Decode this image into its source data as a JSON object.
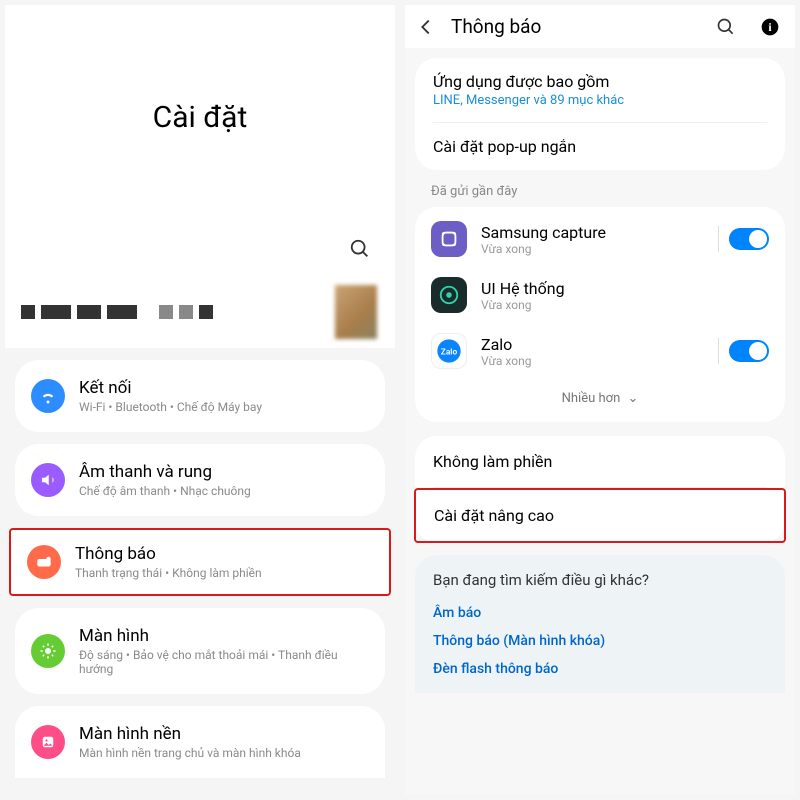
{
  "left": {
    "title": "Cài đặt",
    "items": [
      {
        "name": "ket-noi",
        "title": "Kết nối",
        "sub": "Wi-Fi • Bluetooth • Chế độ Máy bay",
        "color": "#2d8cff",
        "icon": "wifi"
      },
      {
        "name": "am-thanh",
        "title": "Âm thanh và rung",
        "sub": "Chế độ âm thanh • Nhạc chuông",
        "color": "#9a5cff",
        "icon": "sound"
      },
      {
        "name": "thong-bao",
        "title": "Thông báo",
        "sub": "Thanh trạng thái • Không làm phiền",
        "color": "#ff6b4a",
        "icon": "notif",
        "highlight": true
      },
      {
        "name": "man-hinh",
        "title": "Màn hình",
        "sub": "Độ sáng • Bảo vệ cho mắt thoải mái • Thanh điều hướng",
        "color": "#66cc33",
        "icon": "display"
      },
      {
        "name": "man-hinh-nen",
        "title": "Màn hình nền",
        "sub": "Màn hình nền trang chủ và màn hình khóa",
        "color": "#ff4d88",
        "icon": "wallpaper"
      }
    ]
  },
  "right": {
    "headerTitle": "Thông báo",
    "included": {
      "title": "Ứng dụng được bao gồm",
      "sub": "LINE, Messenger và 89 mục khác"
    },
    "popup": "Cài đặt pop-up ngắn",
    "recentLabel": "Đã gửi gần đây",
    "apps": [
      {
        "name": "Samsung capture",
        "time": "Vừa xong",
        "icon": "samsung",
        "toggle": true
      },
      {
        "name": "UI Hệ thống",
        "time": "Vừa xong",
        "icon": "systemui",
        "toggle": false
      },
      {
        "name": "Zalo",
        "time": "Vừa xong",
        "icon": "zalo",
        "toggle": true
      }
    ],
    "more": "Nhiều hơn",
    "dnd": "Không làm phiền",
    "advanced": "Cài đặt nâng cao",
    "suggest": {
      "title": "Bạn đang tìm kiếm điều gì khác?",
      "links": [
        "Âm báo",
        "Thông báo (Màn hình khóa)",
        "Đèn flash thông báo"
      ]
    }
  }
}
